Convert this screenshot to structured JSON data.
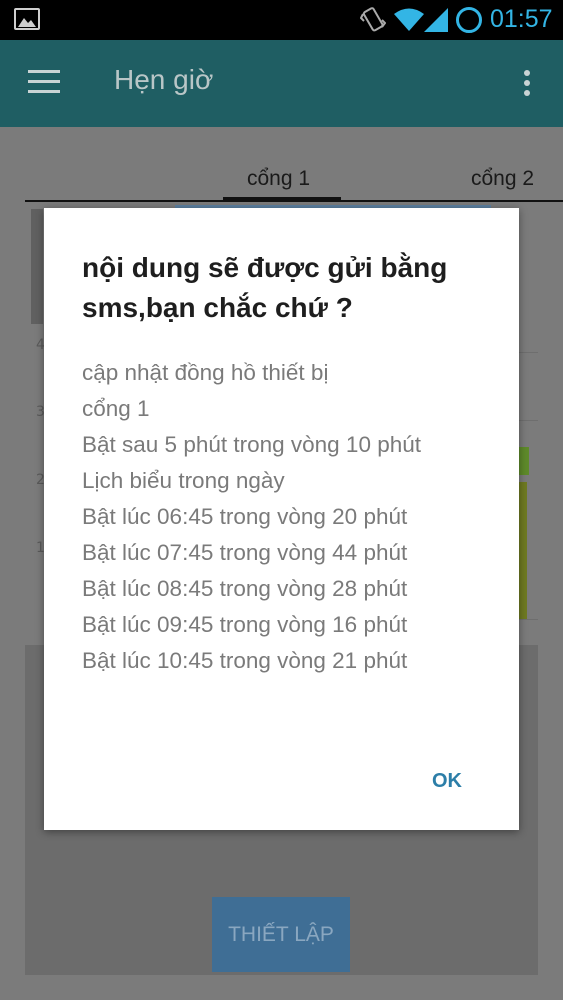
{
  "status_bar": {
    "time": "01:57",
    "icons": [
      "image-icon",
      "vibrate-icon",
      "wifi-icon",
      "signal-icon",
      "battery-icon"
    ],
    "accent_color": "#33b5e5"
  },
  "app_bar": {
    "title": "Hẹn giờ",
    "color": "#1f5e63"
  },
  "tabs": [
    {
      "label": "cổng 1",
      "selected": true
    },
    {
      "label": "cổng 2",
      "selected": false
    }
  ],
  "background": {
    "row_numbers": [
      "4",
      "3",
      "2",
      "1"
    ],
    "setup_button_label": "THIẾT LẬP"
  },
  "dialog": {
    "title": "nội dung sẽ được gửi bằng sms,bạn chắc chứ ?",
    "lines": [
      "cập nhật đồng hồ thiết bị",
      "cổng 1",
      "Bật sau 5 phút trong vòng 10 phút",
      "Lịch biểu trong ngày",
      "Bật lúc 06:45 trong vòng 20 phút",
      "Bật lúc 07:45 trong vòng 44 phút",
      "Bật lúc 08:45 trong vòng 28 phút",
      "Bật lúc 09:45 trong vòng 16 phút",
      "Bật lúc 10:45 trong vòng 21 phút"
    ],
    "ok_label": "OK",
    "ok_color": "#2c7ea8"
  }
}
